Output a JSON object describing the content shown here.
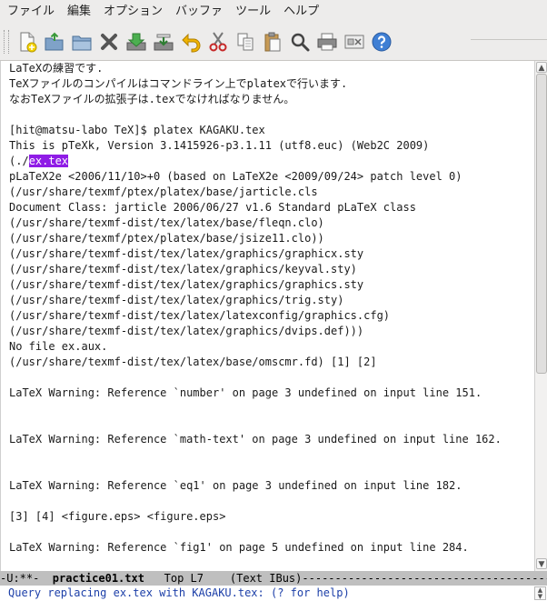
{
  "menubar": {
    "items": [
      "ファイル",
      "編集",
      "オプション",
      "バッファ",
      "ツール",
      "ヘルプ"
    ]
  },
  "toolbar": {
    "buttons": [
      {
        "icon": "new-file-icon"
      },
      {
        "icon": "open-file-icon"
      },
      {
        "icon": "open-directory-icon"
      },
      {
        "icon": "close-icon"
      },
      {
        "icon": "save-icon"
      },
      {
        "icon": "save-as-icon"
      },
      {
        "icon": "undo-icon"
      },
      {
        "icon": "cut-icon"
      },
      {
        "icon": "copy-icon"
      },
      {
        "icon": "paste-icon"
      },
      {
        "icon": "search-icon"
      },
      {
        "icon": "print-icon"
      },
      {
        "icon": "preferences-icon"
      },
      {
        "icon": "help-icon"
      }
    ]
  },
  "editor": {
    "lines": [
      "LaTeXの練習です.",
      "TeXファイルのコンパイルはコマンドライン上でplatexで行います.",
      "なおTeXファイルの拡張子は.texでなければなりません。",
      "",
      "[hit@matsu-labo TeX]$ platex KAGAKU.tex",
      "This is pTeXk, Version 3.1415926-p3.1.11 (utf8.euc) (Web2C 2009)",
      "(./",
      "pLaTeX2e <2006/11/10>+0 (based on LaTeX2e <2009/09/24> patch level 0)",
      "(/usr/share/texmf/ptex/platex/base/jarticle.cls",
      "Document Class: jarticle 2006/06/27 v1.6 Standard pLaTeX class",
      "(/usr/share/texmf-dist/tex/latex/base/fleqn.clo)",
      "(/usr/share/texmf/ptex/platex/base/jsize11.clo))",
      "(/usr/share/texmf-dist/tex/latex/graphics/graphicx.sty",
      "(/usr/share/texmf-dist/tex/latex/graphics/keyval.sty)",
      "(/usr/share/texmf-dist/tex/latex/graphics/graphics.sty",
      "(/usr/share/texmf-dist/tex/latex/graphics/trig.sty)",
      "(/usr/share/texmf-dist/tex/latex/latexconfig/graphics.cfg)",
      "(/usr/share/texmf-dist/tex/latex/graphics/dvips.def)))",
      "No file ex.aux.",
      "(/usr/share/texmf-dist/tex/latex/base/omscmr.fd) [1] [2]",
      "",
      "LaTeX Warning: Reference `number' on page 3 undefined on input line 151.",
      "",
      "",
      "LaTeX Warning: Reference `math-text' on page 3 undefined on input line 162.",
      "",
      "",
      "LaTeX Warning: Reference `eq1' on page 3 undefined on input line 182.",
      "",
      "[3] [4] <figure.eps> <figure.eps>",
      "",
      "LaTeX Warning: Reference `fig1' on page 5 undefined on input line 284."
    ],
    "highlight": {
      "line_index": 6,
      "text": "ex.tex"
    }
  },
  "modeline": {
    "prefix": "-U:**-  ",
    "buffer_name": "practice01.txt",
    "position": "Top L7",
    "mode": "(Text IBus)",
    "fill": "---------------------------------------------------"
  },
  "minibuffer": {
    "text": "Query replacing ex.tex with KAGAKU.tex: (? for help)"
  },
  "colors": {
    "highlight_bg": "#8f1ce6",
    "minibuffer_text": "#1c3fa8",
    "modeline_bg": "#bfbfbf"
  }
}
